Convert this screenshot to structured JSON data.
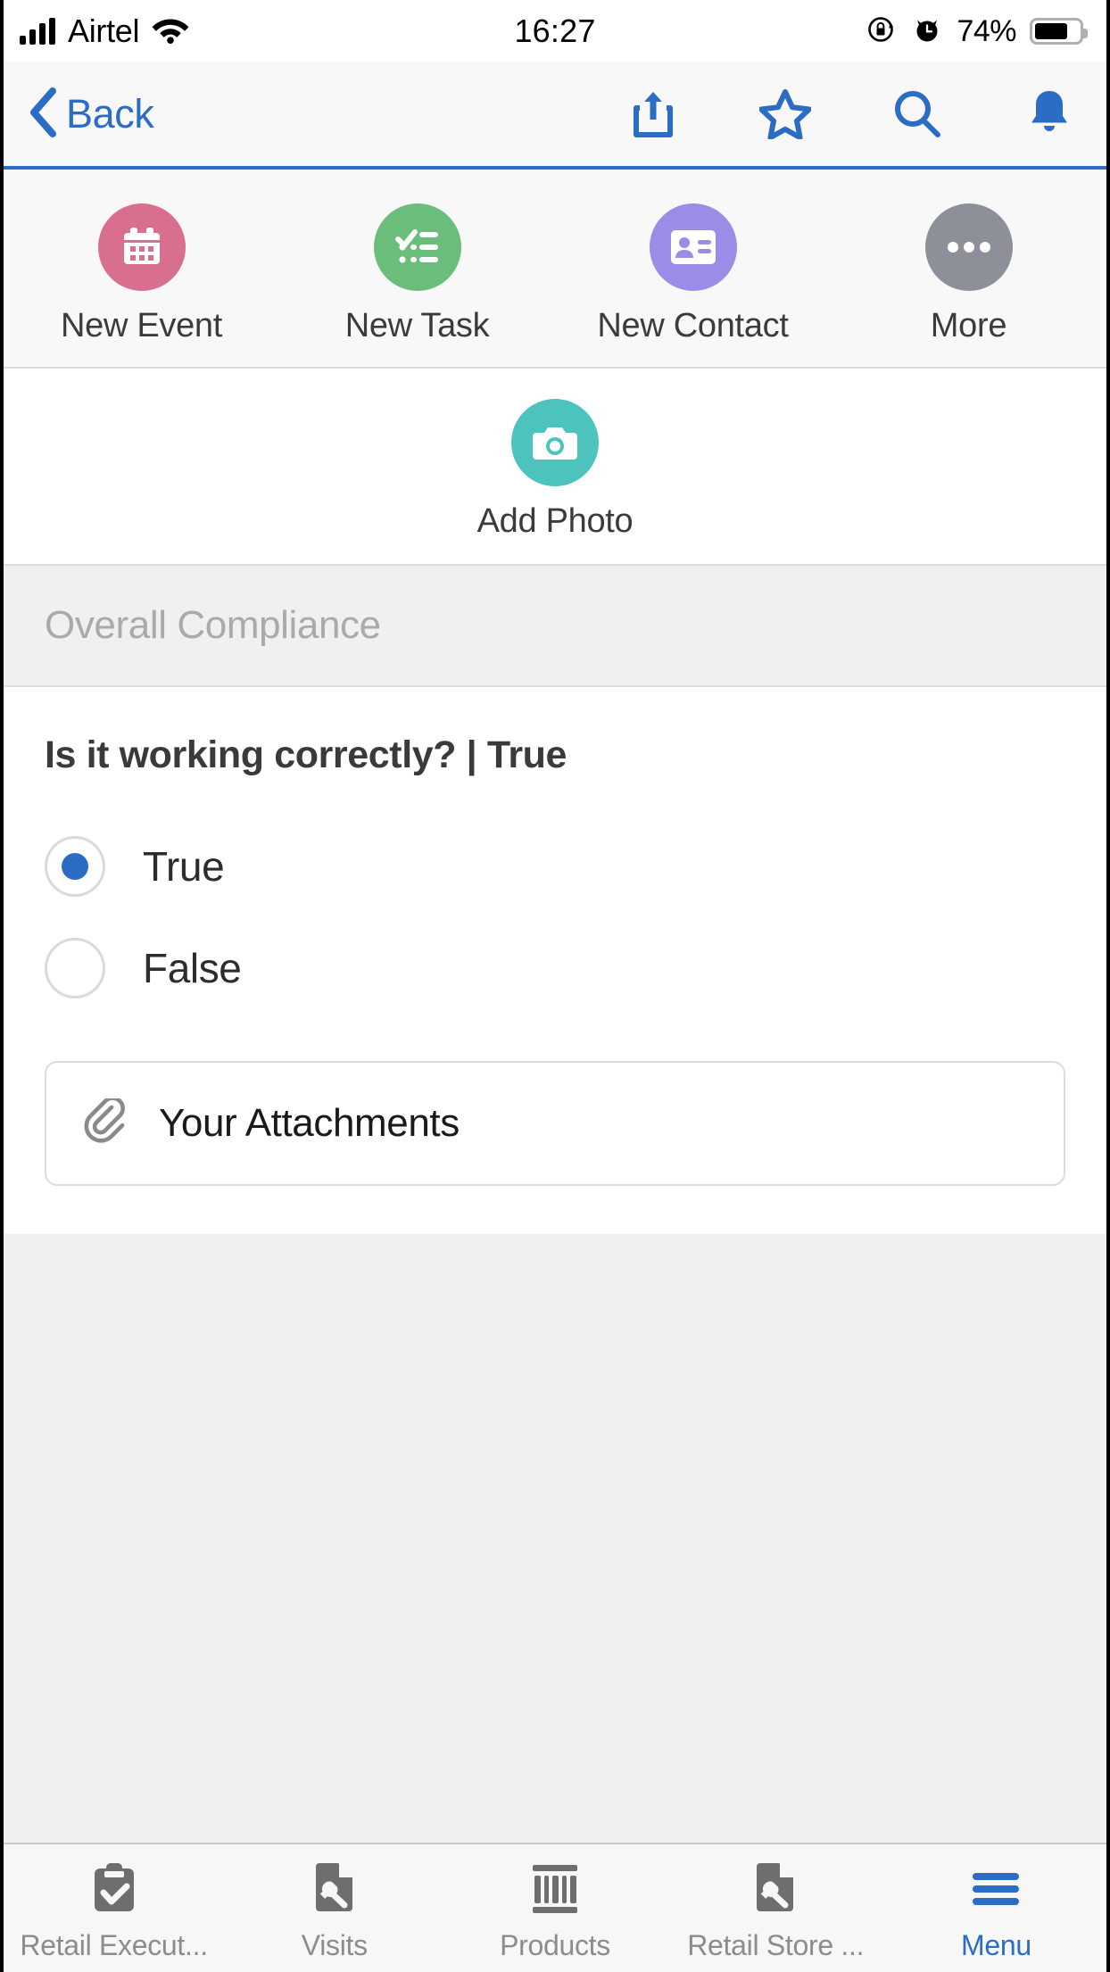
{
  "status_bar": {
    "carrier": "Airtel",
    "signal_icon": "cellular-signal-icon",
    "wifi_icon": "wifi-icon",
    "time": "16:27",
    "rotation_lock_icon": "rotation-lock-icon",
    "alarm_icon": "alarm-clock-icon",
    "battery_percent": "74%",
    "battery_icon": "battery-icon"
  },
  "nav_bar": {
    "back_label": "Back",
    "back_chevron_icon": "chevron-left-icon",
    "icons": [
      {
        "name": "share-icon"
      },
      {
        "name": "star-icon"
      },
      {
        "name": "search-icon"
      },
      {
        "name": "bell-icon"
      }
    ],
    "accent_color": "#2b6cc4"
  },
  "quick_actions": {
    "row1": [
      {
        "label": "New Event",
        "icon": "calendar-icon",
        "color": "#d96f8e"
      },
      {
        "label": "New Task",
        "icon": "checklist-icon",
        "color": "#6bbd7b"
      },
      {
        "label": "New Contact",
        "icon": "contact-card-icon",
        "color": "#9b8ce8"
      },
      {
        "label": "More",
        "icon": "ellipsis-icon",
        "color": "#8d8f99"
      }
    ],
    "row2": [
      {
        "label": "Add Photo",
        "icon": "camera-icon",
        "color": "#4cc3bd"
      }
    ]
  },
  "section": {
    "header": "Overall Compliance"
  },
  "form": {
    "question": "Is it working correctly? | True",
    "options": [
      {
        "label": "True",
        "selected": true
      },
      {
        "label": "False",
        "selected": false
      }
    ],
    "selected_color": "#2b6cc4",
    "attachments": {
      "label": "Your Attachments",
      "icon": "paperclip-icon"
    }
  },
  "tab_bar": {
    "tabs": [
      {
        "label": "Retail Execut...",
        "icon": "clipboard-check-icon",
        "active": false
      },
      {
        "label": "Visits",
        "icon": "document-wrench-icon",
        "active": false
      },
      {
        "label": "Products",
        "icon": "barcode-icon",
        "active": false
      },
      {
        "label": "Retail Store ...",
        "icon": "document-wrench-icon",
        "active": false
      },
      {
        "label": "Menu",
        "icon": "hamburger-menu-icon",
        "active": true
      }
    ],
    "active_color": "#2b6cc4",
    "inactive_color": "#6e6e6e"
  }
}
